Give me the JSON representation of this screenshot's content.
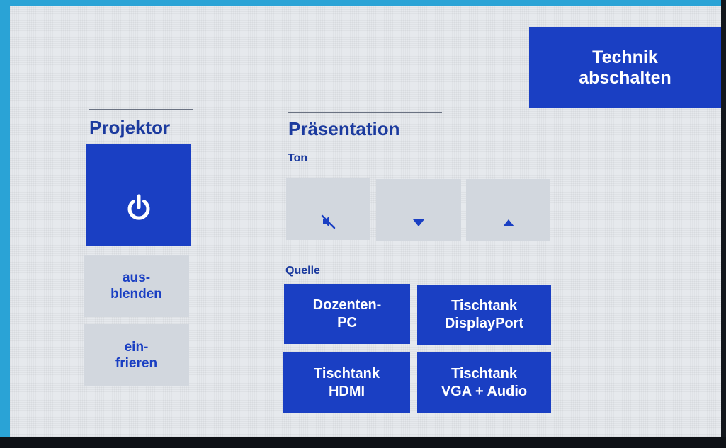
{
  "top_right": {
    "shutdown_label": "Technik\nabschalten"
  },
  "projector": {
    "title": "Projektor",
    "power_icon": "power-icon",
    "blank_label": "aus-\nblenden",
    "freeze_label": "ein-\nfrieren"
  },
  "presentation": {
    "title": "Präsentation",
    "audio": {
      "label": "Ton",
      "mute_icon": "mute-icon",
      "volume_down_icon": "triangle-down-icon",
      "volume_up_icon": "triangle-up-icon"
    },
    "source": {
      "label": "Quelle",
      "buttons": [
        {
          "label": "Dozenten-\nPC"
        },
        {
          "label": "Tischtank\nDisplayPort"
        },
        {
          "label": "Tischtank\nHDMI"
        },
        {
          "label": "Tischtank\nVGA + Audio"
        }
      ]
    }
  },
  "colors": {
    "accent": "#1a3fc3",
    "title_text": "#1b3a9e",
    "inactive_button": "#d2d7de",
    "screen_background": "#e6e9ed"
  }
}
